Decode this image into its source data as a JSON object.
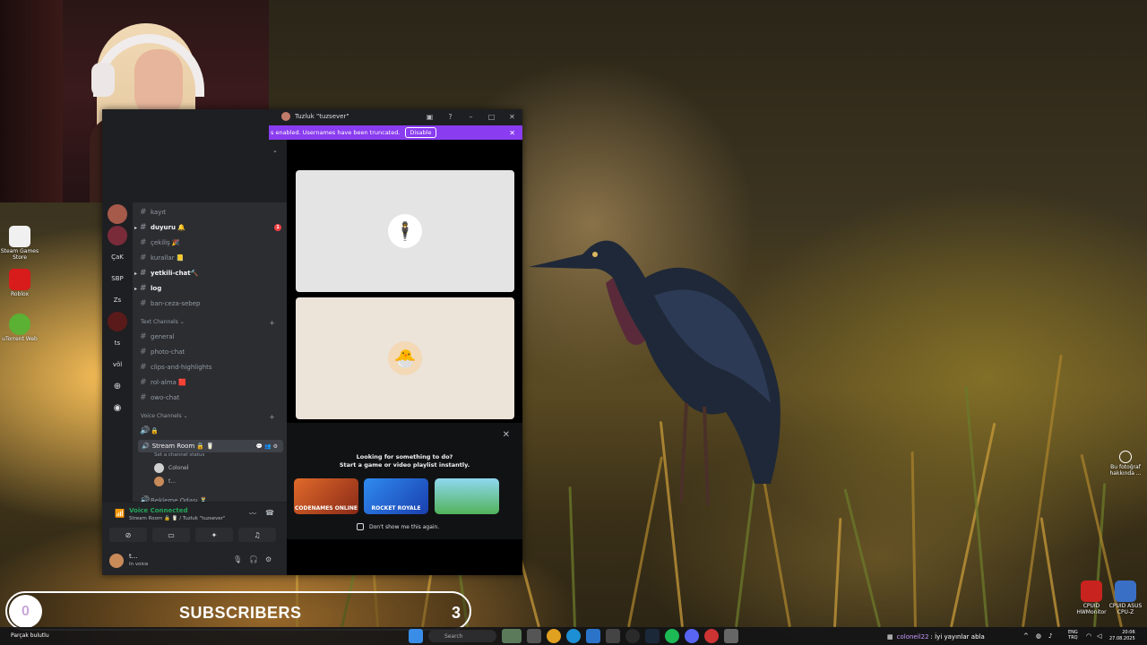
{
  "desktop": {
    "icons": [
      {
        "label": "Steam Games Store"
      },
      {
        "label": "Roblox"
      },
      {
        "label": "uTorrent Web"
      }
    ],
    "tray_apps": [
      {
        "label": "CPUID HWMonitor"
      },
      {
        "label": "CPUID ASUS CPU-Z"
      }
    ],
    "photo_info": "Bu fotoğraf hakkında ..."
  },
  "discord": {
    "window_title": "Tuzluk \"tuzsever\"",
    "banner": {
      "text": "s enabled. Usernames have been truncated.",
      "button": "Disable"
    },
    "servers": [
      "ÇaK",
      "SBP",
      "Zs",
      "ts",
      "völ"
    ],
    "channels_top": [
      {
        "name": "kayıt",
        "bold": false
      },
      {
        "name": "duyuru 🔔",
        "bold": true,
        "badge": "1"
      },
      {
        "name": "çekiliş 🎉",
        "bold": false
      },
      {
        "name": "kurallar 📒",
        "bold": false
      },
      {
        "name": "yetkili-chat🔨",
        "bold": true
      },
      {
        "name": "log",
        "bold": true
      },
      {
        "name": "ban-ceza-sebep",
        "bold": false
      }
    ],
    "text_category": "Text Channels",
    "text_channels": [
      "general",
      "photo-chat",
      "clips-and-highlights",
      "rol-alma 🟥",
      "owo-chat"
    ],
    "voice_category": "Voice Channels",
    "voice_channels": {
      "locked": "🔒",
      "stream_room": "Stream Room 🔒 🥛",
      "status_hint": "Set a channel status",
      "members": [
        "Coloneİ",
        "t..."
      ],
      "waiting_room": "Bekleme Odası ⏳"
    },
    "voice_connected": {
      "title": "Voice Connected",
      "subtitle": "Stream Room 🔒 🥛 / Tuzluk \"tuzsever\""
    },
    "user": {
      "name": "t...",
      "status": "In voice"
    },
    "activity": {
      "title_line1": "Looking for something to do?",
      "title_line2": "Start a game or video playlist instantly.",
      "games": [
        {
          "name": "CODENAMES ONLINE",
          "color": "#c1441f"
        },
        {
          "name": "ROCKET ROYALE",
          "color": "#1d5cd6"
        },
        {
          "name": "",
          "color": "#52b35a"
        }
      ],
      "dont_show": "Don't show me this again."
    },
    "colors": {
      "accent": "#8a3cf0",
      "voice_green": "#23a55a",
      "tile1_bg": "#e4e4e4",
      "tile2_bg": "#ece3d9"
    }
  },
  "overlay": {
    "subscribers_count": "0",
    "subscribers_label": "SUBSCRIBERS",
    "subscribers_goal": "3"
  },
  "taskbar": {
    "now_playing": "Parçak bulutlu",
    "search_placeholder": "Search",
    "chat_user": "coloneil22",
    "chat_message": ": İyi yayınlar abla",
    "lang_line1": "ENG",
    "lang_line2": "TRQ",
    "time": "20:06",
    "date": "27.08.2025"
  }
}
